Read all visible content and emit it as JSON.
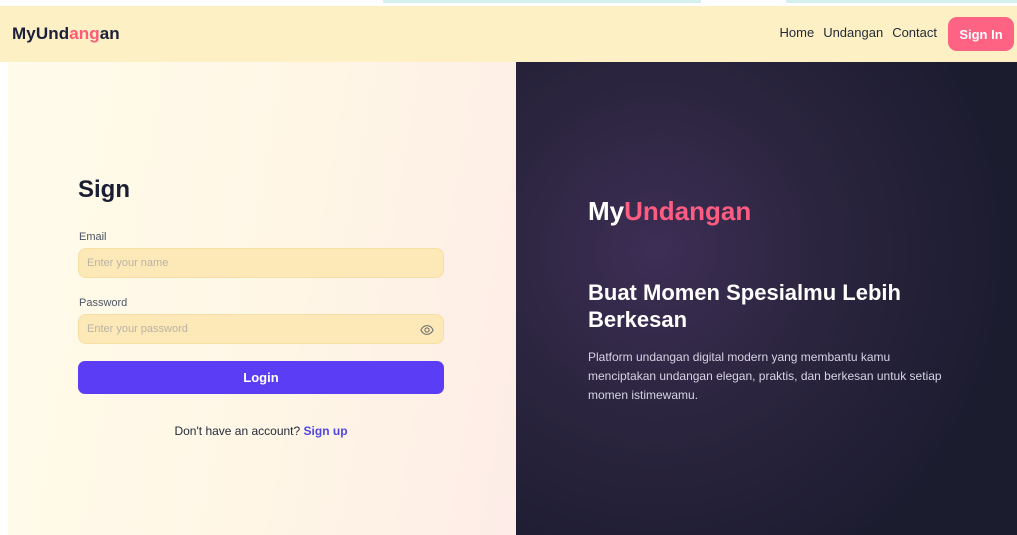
{
  "navbar": {
    "brand_part1": "My",
    "brand_part2": "Und",
    "brand_part3": "ang",
    "brand_part4": "an",
    "links": [
      "Home",
      "Undangan",
      "Contact"
    ],
    "signin_label": "Sign In"
  },
  "form": {
    "title": "Sign",
    "email_label": "Email",
    "email_placeholder": "Enter your name",
    "email_value": "",
    "password_label": "Password",
    "password_placeholder": "Enter your password",
    "password_value": "",
    "password_toggle_icon": "eye-icon",
    "login_label": "Login",
    "signup_prompt": "Don't have an account?",
    "signup_link": "Sign up"
  },
  "hero": {
    "brand_prefix": "My",
    "brand_suffix": "Undangan",
    "heading": "Buat Momen Spesialmu Lebih Berkesan",
    "description": "Platform undangan digital modern yang membantu kamu menciptakan undangan elegan, praktis, dan berkesan untuk setiap momen istimewamu."
  },
  "colors": {
    "navbar_bg": "#fdf0c4",
    "accent_pink": "#ff6384",
    "primary_purple": "#5b3df5",
    "hero_bg": "#2c2540",
    "input_bg": "#fde9b8"
  }
}
